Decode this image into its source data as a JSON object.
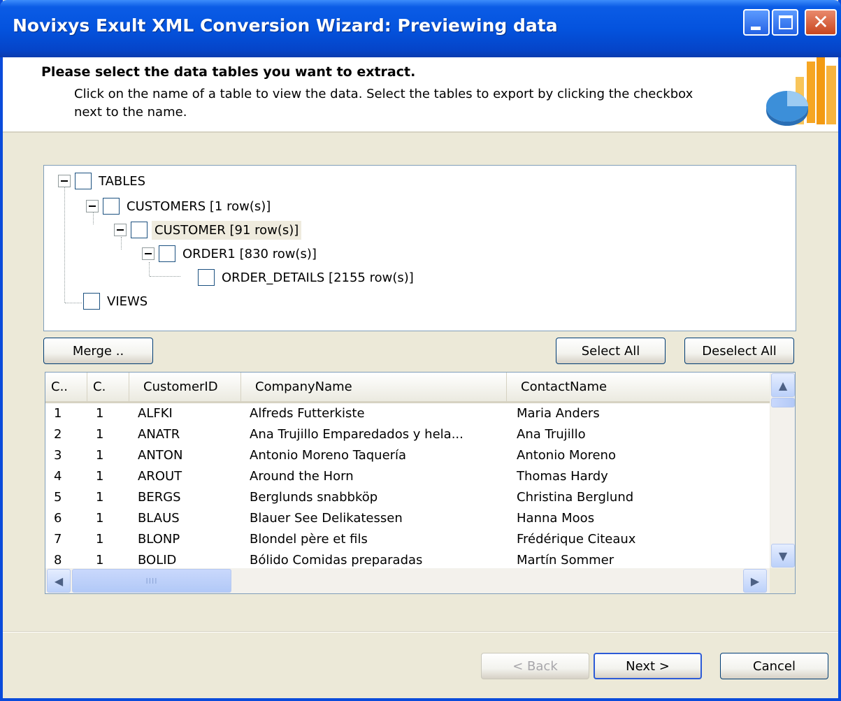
{
  "window": {
    "title": "Novixys Exult XML Conversion Wizard: Previewing data",
    "minimize_glyph": "",
    "maximize_glyph": "",
    "close_glyph": "✕"
  },
  "header": {
    "title": "Please select the data tables you want to extract.",
    "description": "Click on the name of a table to view the data. Select the tables to export by clicking the checkbox next to the name."
  },
  "tree": {
    "tables": "TABLES",
    "customers": "CUSTOMERS [1 row(s)]",
    "customer": "CUSTOMER [91 row(s)]",
    "order1": "ORDER1 [830 row(s)]",
    "order_details": "ORDER_DETAILS [2155 row(s)]",
    "views": "VIEWS"
  },
  "buttons": {
    "merge": "Merge ..",
    "select_all": "Select All",
    "deselect_all": "Deselect All",
    "back": "< Back",
    "next": "Next >",
    "cancel": "Cancel"
  },
  "grid": {
    "columns": [
      "C..",
      "C.",
      "CustomerID",
      "CompanyName",
      "ContactName"
    ],
    "rows": [
      [
        "1",
        "1",
        "ALFKI",
        "Alfreds Futterkiste",
        "Maria Anders"
      ],
      [
        "2",
        "1",
        "ANATR",
        "Ana Trujillo Emparedados y hela...",
        "Ana Trujillo"
      ],
      [
        "3",
        "1",
        "ANTON",
        "Antonio Moreno Taquería",
        "Antonio Moreno"
      ],
      [
        "4",
        "1",
        "AROUT",
        "Around the Horn",
        "Thomas Hardy"
      ],
      [
        "5",
        "1",
        "BERGS",
        "Berglunds snabbköp",
        "Christina Berglund"
      ],
      [
        "6",
        "1",
        "BLAUS",
        "Blauer See Delikatessen",
        "Hanna Moos"
      ],
      [
        "7",
        "1",
        "BLONP",
        "Blondel père et fils",
        "Frédérique Citeaux"
      ],
      [
        "8",
        "1",
        "BOLID",
        "Bólido Comidas preparadas",
        "Martín Sommer"
      ]
    ],
    "scroll_up_glyph": "▲",
    "scroll_down_glyph": "▼",
    "scroll_left_glyph": "◀",
    "scroll_right_glyph": "▶",
    "thumb_grip": "IIII"
  },
  "colors": {
    "titlebar": "#0453DE",
    "dialog_bg": "#ECE9D8",
    "selected_node": "#EFEBDE"
  }
}
